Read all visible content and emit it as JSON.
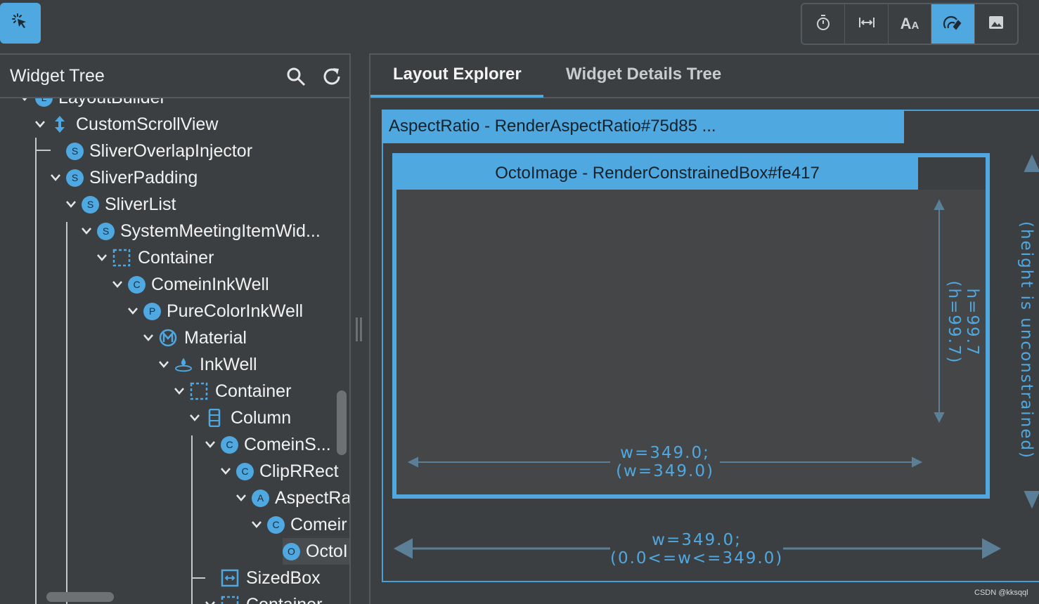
{
  "toolbar": {
    "select_widget_icon": "select-widget-icon",
    "buttons": [
      {
        "icon": "timer-icon",
        "active": false
      },
      {
        "icon": "baseline-width-icon",
        "active": false
      },
      {
        "icon": "text-baseline-icon",
        "active": false
      },
      {
        "icon": "repaint-rainbow-icon",
        "active": true
      },
      {
        "icon": "image-icon",
        "active": false
      }
    ],
    "aa_glyph_big": "A",
    "aa_glyph_small": "A"
  },
  "tree": {
    "title": "Widget Tree",
    "search_icon": "search-icon",
    "refresh_icon": "refresh-icon",
    "rows": [
      {
        "label": "LayoutBuilder",
        "badge": "L"
      },
      {
        "label": "CustomScrollView",
        "badge": "scroll"
      },
      {
        "label": "SliverOverlapInjector",
        "badge": "S"
      },
      {
        "label": "SliverPadding",
        "badge": "S"
      },
      {
        "label": "SliverList",
        "badge": "S"
      },
      {
        "label": "SystemMeetingItemWid...",
        "badge": "S"
      },
      {
        "label": "Container",
        "badge": "container"
      },
      {
        "label": "ComeinInkWell",
        "badge": "C"
      },
      {
        "label": "PureColorInkWell",
        "badge": "P"
      },
      {
        "label": "Material",
        "badge": "material"
      },
      {
        "label": "InkWell",
        "badge": "inkwell"
      },
      {
        "label": "Container",
        "badge": "container"
      },
      {
        "label": "Column",
        "badge": "column"
      },
      {
        "label": "ComeinS...",
        "badge": "C"
      },
      {
        "label": "ClipRRect",
        "badge": "C"
      },
      {
        "label": "AspectRa",
        "badge": "A"
      },
      {
        "label": "Comeir",
        "badge": "C"
      },
      {
        "label": "OctoI",
        "badge": "O"
      },
      {
        "label": "SizedBox",
        "badge": "sizedbox"
      },
      {
        "label": "Container",
        "badge": "container"
      }
    ]
  },
  "tabs": [
    {
      "label": "Layout Explorer",
      "active": true
    },
    {
      "label": "Widget Details Tree",
      "active": false
    }
  ],
  "layout": {
    "outer_title": "AspectRatio - RenderAspectRatio#75d85 ...",
    "inner_title": "OctoImage - RenderConstrainedBox#fe417",
    "inner_width_line1": "w=349.0;",
    "inner_width_line2": "(w=349.0)",
    "inner_height_line1": "h=99.7",
    "inner_height_line2": "(h=99.7)",
    "outer_width_line1": "w=349.0;",
    "outer_width_line2": "(0.0<=w<=349.0)",
    "outer_height": "(height is unconstrained)"
  },
  "watermark": "CSDN @kksqql",
  "colors": {
    "accent": "#4fa8e0",
    "background": "#3c3f41"
  }
}
